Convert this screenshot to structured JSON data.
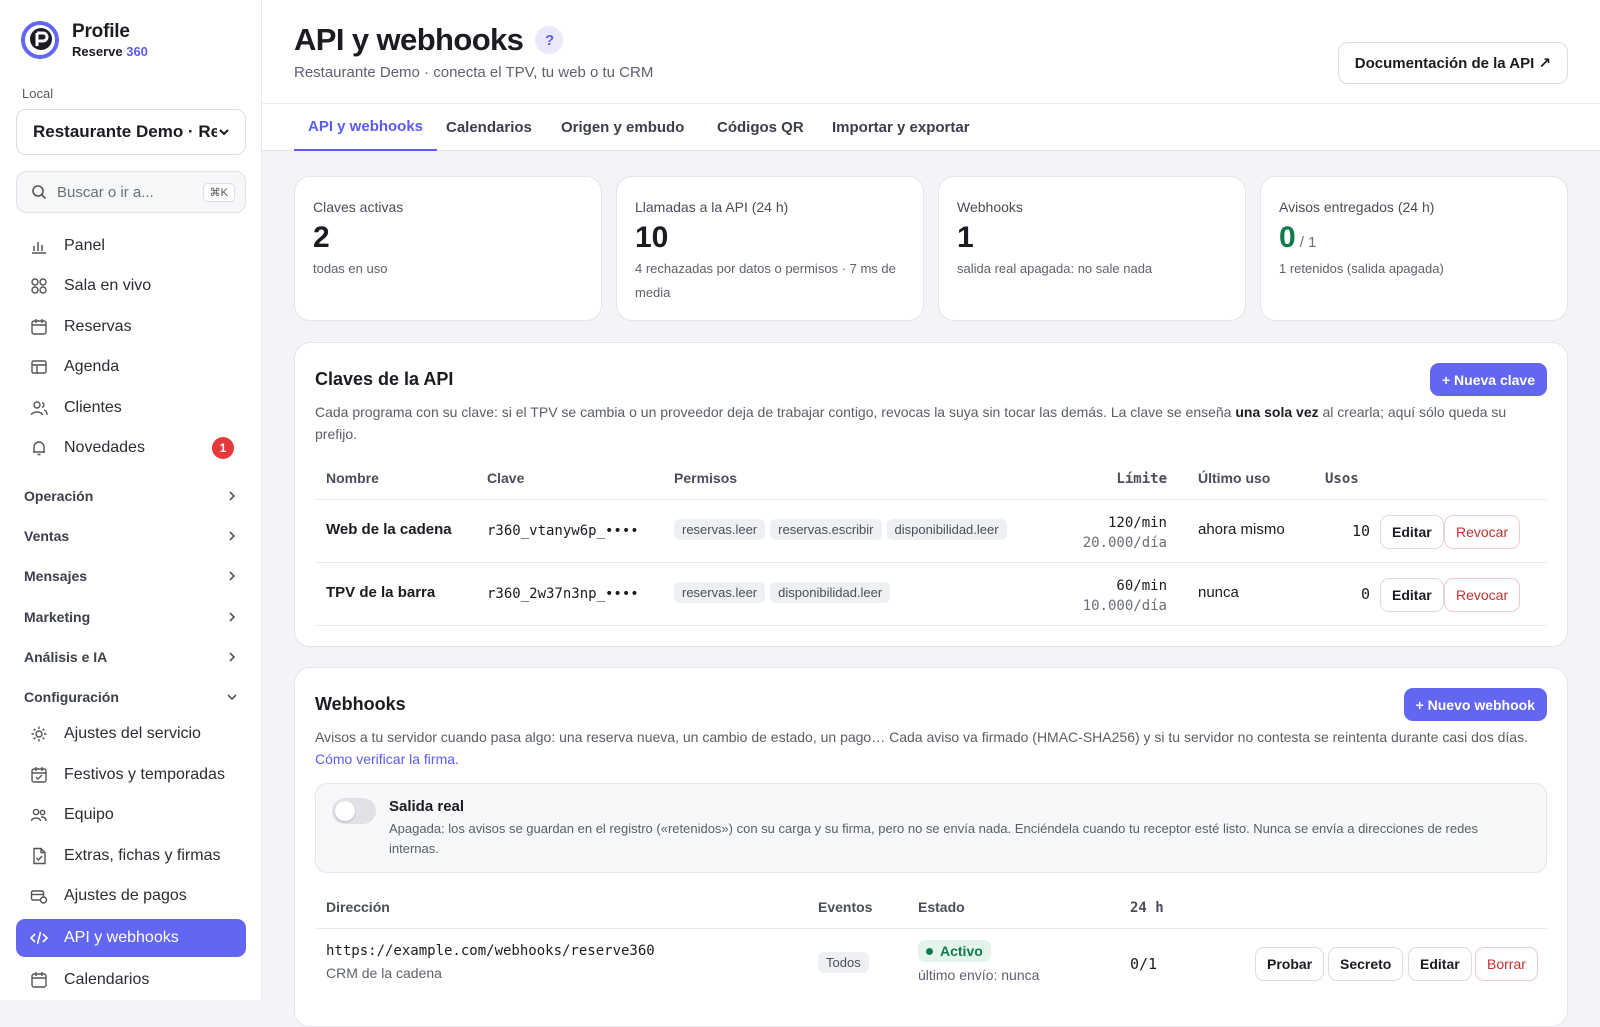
{
  "brand": {
    "name": "Profile",
    "sub_prefix": "Reserve ",
    "sub_accent": "360"
  },
  "local": {
    "label": "Local",
    "value": "Restaurante Demo · Res"
  },
  "search": {
    "placeholder": "Buscar o ir a...",
    "shortcut": "⌘K"
  },
  "nav": [
    {
      "label": "Panel",
      "icon": "bar-chart-icon"
    },
    {
      "label": "Sala en vivo",
      "icon": "grid-icon"
    },
    {
      "label": "Reservas",
      "icon": "calendar-icon"
    },
    {
      "label": "Agenda",
      "icon": "table-icon"
    },
    {
      "label": "Clientes",
      "icon": "users-icon"
    },
    {
      "label": "Novedades",
      "icon": "bell-icon",
      "badge": "1"
    }
  ],
  "groups": [
    "Operación",
    "Ventas",
    "Mensajes",
    "Marketing",
    "Análisis e IA",
    "Configuración"
  ],
  "config_items": [
    {
      "label": "Ajustes del servicio",
      "icon": "sun-settings-icon"
    },
    {
      "label": "Festivos y temporadas",
      "icon": "calendar-check-icon"
    },
    {
      "label": "Equipo",
      "icon": "team-icon"
    },
    {
      "label": "Extras, fichas y firmas",
      "icon": "document-icon"
    },
    {
      "label": "Ajustes de pagos",
      "icon": "payment-icon"
    },
    {
      "label": "API y webhooks",
      "icon": "code-icon",
      "active": true
    },
    {
      "label": "Calendarios",
      "icon": "calendar-icon"
    }
  ],
  "header": {
    "title": "API y webhooks",
    "help": "?",
    "subtitle": "Restaurante Demo · conecta el TPV, tu web o tu CRM",
    "doc_button": "Documentación de la API ↗"
  },
  "tabs": [
    "API y webhooks",
    "Calendarios",
    "Origen y embudo",
    "Códigos QR",
    "Importar y exportar"
  ],
  "stats": [
    {
      "label": "Claves activas",
      "value": "2",
      "suffix": "",
      "desc": "todas en uso"
    },
    {
      "label": "Llamadas a la API (24 h)",
      "value": "10",
      "suffix": "",
      "desc": "4 rechazadas por datos o permisos · 7 ms de media"
    },
    {
      "label": "Webhooks",
      "value": "1",
      "suffix": "",
      "desc": "salida real apagada: no sale nada"
    },
    {
      "label": "Avisos entregados (24 h)",
      "value": "0",
      "suffix": "/ 1",
      "desc": "1 retenidos (salida apagada)"
    }
  ],
  "keys": {
    "title": "Claves de la API",
    "new_button": "+ Nueva clave",
    "desc_before": "Cada programa con su clave: si el TPV se cambia o un proveedor deja de trabajar contigo, revocas la suya sin tocar las demás. La clave se enseña ",
    "desc_bold": "una sola vez",
    "desc_after": " al crearla; aquí sólo queda su prefijo.",
    "columns": {
      "name": "Nombre",
      "key": "Clave",
      "perms": "Permisos",
      "limit": "Límite",
      "last": "Último uso",
      "uses": "Usos"
    },
    "rows": [
      {
        "name": "Web de la cadena",
        "key": "r360_vtanyw6p_••••",
        "perms": [
          "reservas.leer",
          "reservas.escribir",
          "disponibilidad.leer"
        ],
        "limit_min": "120/min",
        "limit_day": "20.000/día",
        "last": "ahora mismo",
        "uses": "10",
        "edit": "Editar",
        "revoke": "Revocar"
      },
      {
        "name": "TPV de la barra",
        "key": "r360_2w37n3np_••••",
        "perms": [
          "reservas.leer",
          "disponibilidad.leer"
        ],
        "limit_min": "60/min",
        "limit_day": "10.000/día",
        "last": "nunca",
        "uses": "0",
        "edit": "Editar",
        "revoke": "Revocar"
      }
    ]
  },
  "webhooks": {
    "title": "Webhooks",
    "new_button": "+ Nuevo webhook",
    "desc_before": "Avisos a tu servidor cuando pasa algo: una reserva nueva, un cambio de estado, un pago… Cada aviso va firmado (HMAC-SHA256) y si tu servidor no contesta se reintenta durante casi dos días. ",
    "desc_link": "Cómo verificar la firma.",
    "salida": {
      "title": "Salida real",
      "desc": "Apagada: los avisos se guardan en el registro («retenidos») con su carga y su firma, pero no se envía nada. Enciéndela cuando tu receptor esté listo. Nunca se envía a direcciones de redes internas."
    },
    "columns": {
      "url": "Dirección",
      "events": "Eventos",
      "status": "Estado",
      "h24": "24 h"
    },
    "rows": [
      {
        "url": "https://example.com/webhooks/reserve360",
        "label": "CRM de la cadena",
        "events": "Todos",
        "status": "Activo",
        "last_send": "último envío: nunca",
        "h24": "0/1",
        "test": "Probar",
        "secret": "Secreto",
        "edit": "Editar",
        "delete": "Borrar"
      }
    ]
  },
  "colors": {
    "accent": "#6366f1",
    "danger": "#c53030",
    "success": "#117a4b"
  }
}
